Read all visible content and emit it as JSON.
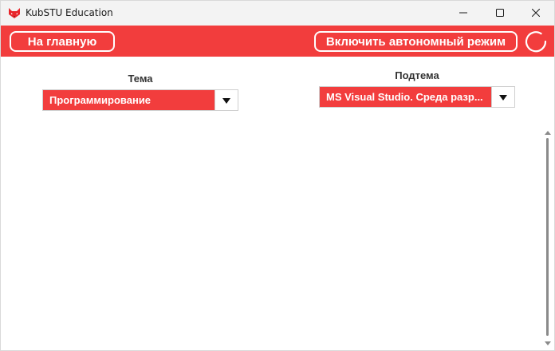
{
  "window": {
    "title": "KubSTU Education",
    "icon": "fox-logo-icon",
    "controls": [
      "minimize-icon",
      "maximize-icon",
      "close-icon"
    ]
  },
  "toolbar": {
    "home_label": "На главную",
    "offline_label": "Включить автономный режим",
    "refresh_icon": "refresh-icon",
    "background_color": "#f23d3d"
  },
  "filters": {
    "topic": {
      "label": "Тема",
      "selected": "Программирование"
    },
    "subtopic": {
      "label": "Подтема",
      "selected": "MS Visual Studio. Среда разр..."
    }
  },
  "colors": {
    "accent": "#f23d3d",
    "titlebar": "#f3f3f3"
  }
}
